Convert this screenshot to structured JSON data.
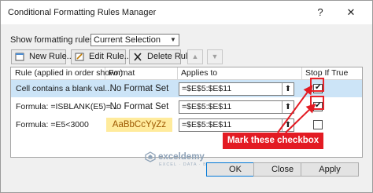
{
  "window": {
    "title": "Conditional Formatting Rules Manager",
    "help_label": "?",
    "close_label": "✕"
  },
  "filter": {
    "label": "Show formatting rules for:",
    "selected": "Current Selection"
  },
  "toolbar": {
    "new_rule": "New Rule...",
    "edit_rule": "Edit Rule...",
    "delete_rule": "Delete Rule",
    "move_up": "▲",
    "move_down": "▼"
  },
  "table": {
    "columns": [
      "Rule (applied in order shown)",
      "Format",
      "Applies to",
      "Stop If True"
    ],
    "rows": [
      {
        "rule": "Cell contains a blank val...",
        "format": "No Format Set",
        "applies_to": "=$E$5:$E$11",
        "stop_if_true": true,
        "selected": true
      },
      {
        "rule": "Formula: =ISBLANK(E5)=...",
        "format": "No Format Set",
        "applies_to": "=$E$5:$E$11",
        "stop_if_true": true,
        "selected": false
      },
      {
        "rule": "Formula: =E5<3000",
        "format": "AaBbCcYyZz",
        "applies_to": "=$E$5:$E$11",
        "stop_if_true": false,
        "selected": false
      }
    ]
  },
  "annotation": {
    "callout": "Mark these checkbox",
    "color": "#e31b23"
  },
  "watermark": {
    "brand": "exceldemy",
    "tagline": "EXCEL · DATA · BI"
  },
  "buttons": {
    "ok": "OK",
    "close": "Close",
    "apply": "Apply"
  },
  "colors": {
    "selected_row": "#cce4f7",
    "preview_fill": "#ffeb9c",
    "preview_text": "#9c5700"
  }
}
